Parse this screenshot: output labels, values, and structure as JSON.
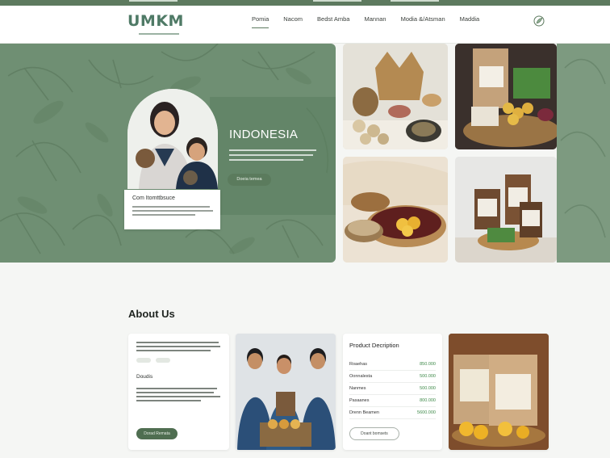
{
  "colors": {
    "brand": "#5d7a5f",
    "accent_green": "#4f6e51",
    "price_green": "#3f8a4a",
    "hero_bg": "#6f8f73"
  },
  "brand": {
    "logo_text": "UMKM"
  },
  "nav": {
    "items": [
      {
        "label": "Pomia",
        "active": true
      },
      {
        "label": "Nacom",
        "active": false
      },
      {
        "label": "Bedst Amba",
        "active": false
      },
      {
        "label": "Mannan",
        "active": false
      },
      {
        "label": "Modia &/Atsman",
        "active": false
      },
      {
        "label": "Maddia",
        "active": false
      }
    ],
    "icon": "leaf-icon"
  },
  "hero": {
    "title": "INDONESIA",
    "cta_label": "Doeia temea",
    "card_title": "Com Itomttbsuce"
  },
  "about": {
    "heading": "About Us",
    "intro_card": {
      "subheading": "Doudis",
      "button_label": "Dorad Remata"
    },
    "product_card": {
      "title": "Product Decription",
      "rows": [
        {
          "name": "Roaehas",
          "price": "850.000"
        },
        {
          "name": "Oonnalesta",
          "price": "500.000"
        },
        {
          "name": "Nanmes",
          "price": "500.000"
        },
        {
          "name": "Pasaanes",
          "price": "800.000"
        },
        {
          "name": "Drenn Beamen",
          "price": "5600.000"
        }
      ],
      "button_label": "Doant bomsets"
    }
  }
}
